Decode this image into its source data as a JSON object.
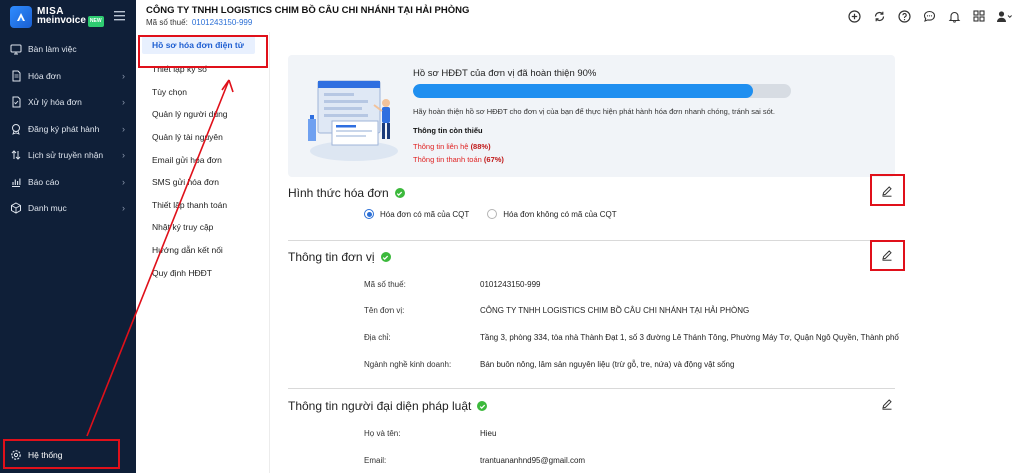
{
  "brand": {
    "line1": "MISA",
    "line2": "meinvoice",
    "badge": "NEW"
  },
  "sidebar": {
    "items": [
      {
        "label": "Bàn làm việc",
        "icon": "monitor-icon",
        "chevron": false
      },
      {
        "label": "Hóa đơn",
        "icon": "invoice-icon",
        "chevron": true
      },
      {
        "label": "Xử lý hóa đơn",
        "icon": "process-invoice-icon",
        "chevron": true
      },
      {
        "label": "Đăng ký phát hành",
        "icon": "register-icon",
        "chevron": true
      },
      {
        "label": "Lịch sử truyền nhận",
        "icon": "transfer-history-icon",
        "chevron": true
      },
      {
        "label": "Báo cáo",
        "icon": "report-icon",
        "chevron": true
      },
      {
        "label": "Danh mục",
        "icon": "catalog-icon",
        "chevron": true
      }
    ],
    "bottom": {
      "label": "Hệ thống",
      "icon": "gear-icon"
    }
  },
  "header": {
    "company": "CÔNG TY TNHH LOGISTICS CHIM BỒ CÂU CHI NHÁNH TẠI HẢI PHÒNG",
    "tax_label": "Mã số thuế:",
    "tax_value": "0101243150-999"
  },
  "submenu": {
    "active": "Hồ sơ hóa đơn điện tử",
    "items": [
      "Thiết lập ký số",
      "Tùy chọn",
      "Quản lý người dùng",
      "Quản lý tài nguyên",
      "Email gửi hóa đơn",
      "SMS gửi hóa đơn",
      "Thiết lập thanh toán",
      "Nhật ký truy cập",
      "Hướng dẫn kết nối",
      "Quy định HĐĐT"
    ]
  },
  "banner": {
    "title": "Hồ sơ HĐĐT của đơn vị đã hoàn thiện 90%",
    "progress": 0.9,
    "desc": "Hãy hoàn thiện hồ sơ HĐĐT cho đơn vị của bạn để thực hiện phát hành hóa đơn nhanh chóng, tránh sai sót.",
    "missing_title": "Thông tin còn thiếu",
    "missing": [
      {
        "text": "Thông tin liên hệ",
        "pct": "(88%)"
      },
      {
        "text": "Thông tin thanh toán",
        "pct": "(67%)"
      }
    ]
  },
  "invoice_type": {
    "title": "Hình thức hóa đơn",
    "options": [
      {
        "label": "Hóa đơn có mã của CQT",
        "selected": true
      },
      {
        "label": "Hóa đơn không có mã của CQT",
        "selected": false
      }
    ]
  },
  "unit_info": {
    "title": "Thông tin đơn vị",
    "fields": [
      {
        "label": "Mã số thuế:",
        "value": "0101243150-999"
      },
      {
        "label": "Tên đơn vị:",
        "value": "CÔNG TY TNHH LOGISTICS CHIM BỒ CÂU CHI NHÁNH TẠI HẢI PHÒNG"
      },
      {
        "label": "Địa chỉ:",
        "value": "Tầng 3, phòng 334, tòa nhà Thành Đạt 1, số 3 đường Lê Thánh Tông, Phường Máy Tơ, Quận Ngô Quyền, Thành phố"
      },
      {
        "label": "Ngành nghề kinh doanh:",
        "value": "Bán buôn nông, lâm sản nguyên liệu (trừ gỗ, tre, nứa) và động vật sống"
      }
    ]
  },
  "legal_rep": {
    "title": "Thông tin người đại diện pháp luật",
    "fields": [
      {
        "label": "Họ và tên:",
        "value": "Hieu"
      },
      {
        "label": "Email:",
        "value": "trantuananhnd95@gmail.com"
      }
    ]
  },
  "colors": {
    "sidebar_bg": "#0f1f38",
    "accent": "#2b6fd6",
    "annotation": "#e0101a",
    "progress": "#1f8ff0"
  }
}
